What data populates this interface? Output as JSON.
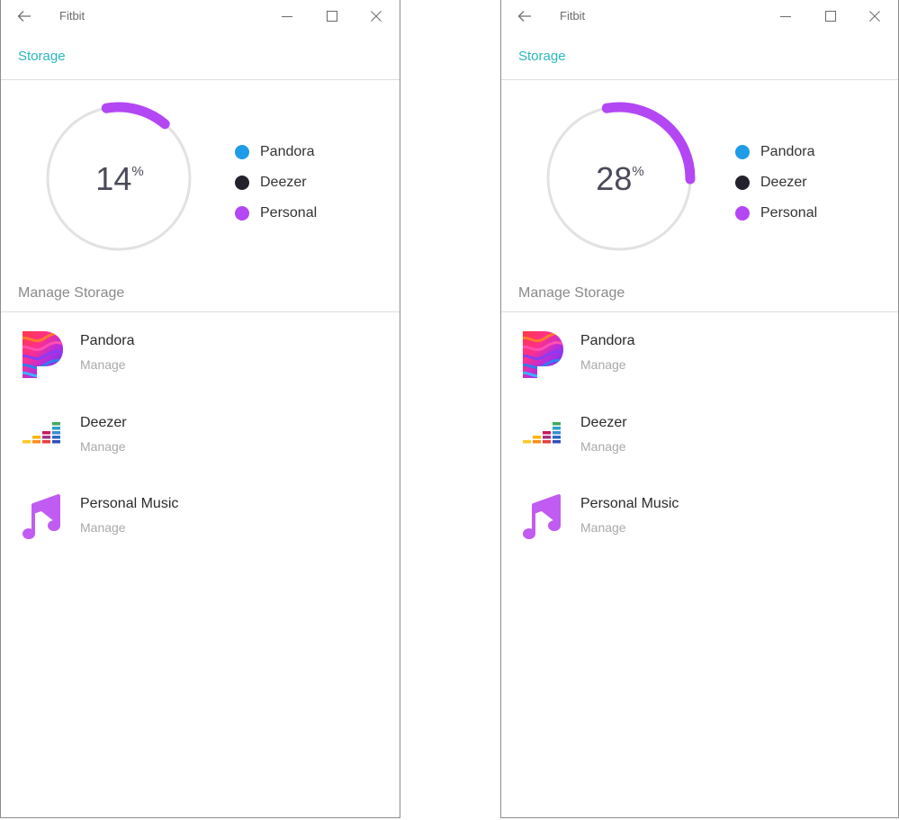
{
  "windows": [
    {
      "app_title": "Fitbit",
      "page_title": "Storage",
      "chart_data": {
        "type": "pie",
        "title": "",
        "center_value": "14",
        "center_unit": "%",
        "percent_used": 14,
        "series": [
          {
            "name": "Personal",
            "value": 14,
            "color": "#b347f3"
          }
        ],
        "track_color": "#e2e2e2"
      },
      "legend": [
        {
          "label": "Pandora",
          "color": "#1f9ce8"
        },
        {
          "label": "Deezer",
          "color": "#23222c"
        },
        {
          "label": "Personal",
          "color": "#b347f3"
        }
      ],
      "section_title": "Manage Storage",
      "items": [
        {
          "name": "Pandora",
          "action": "Manage",
          "icon": "pandora-logo-icon"
        },
        {
          "name": "Deezer",
          "action": "Manage",
          "icon": "deezer-logo-icon"
        },
        {
          "name": "Personal Music",
          "action": "Manage",
          "icon": "music-note-icon"
        }
      ]
    },
    {
      "app_title": "Fitbit",
      "page_title": "Storage",
      "chart_data": {
        "type": "pie",
        "title": "",
        "center_value": "28",
        "center_unit": "%",
        "percent_used": 28,
        "series": [
          {
            "name": "Personal",
            "value": 28,
            "color": "#b347f3"
          }
        ],
        "track_color": "#e2e2e2"
      },
      "legend": [
        {
          "label": "Pandora",
          "color": "#1f9ce8"
        },
        {
          "label": "Deezer",
          "color": "#23222c"
        },
        {
          "label": "Personal",
          "color": "#b347f3"
        }
      ],
      "section_title": "Manage Storage",
      "items": [
        {
          "name": "Pandora",
          "action": "Manage",
          "icon": "pandora-logo-icon"
        },
        {
          "name": "Deezer",
          "action": "Manage",
          "icon": "deezer-logo-icon"
        },
        {
          "name": "Personal Music",
          "action": "Manage",
          "icon": "music-note-icon"
        }
      ]
    }
  ]
}
